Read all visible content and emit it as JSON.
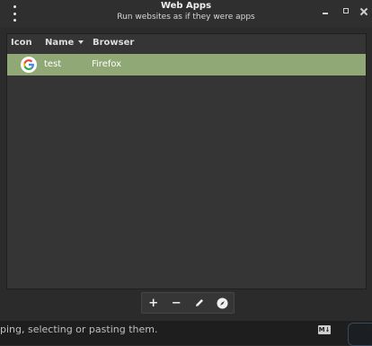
{
  "window": {
    "title": "Web Apps",
    "subtitle": "Run websites as if they were apps"
  },
  "table": {
    "columns": [
      "Icon",
      "Name",
      "Browser"
    ],
    "rows": [
      {
        "icon": "google-g-icon",
        "name": "test",
        "browser": "Firefox"
      }
    ]
  },
  "toolbar": {
    "add_label": "+",
    "remove_label": "−",
    "edit_icon": "pencil-icon",
    "launch_icon": "compass-icon"
  },
  "background": {
    "text": "ping, selecting or pasting them.",
    "badge": "M↓"
  },
  "colors": {
    "selection": "#8fa876",
    "background": "#2b2b2b"
  }
}
